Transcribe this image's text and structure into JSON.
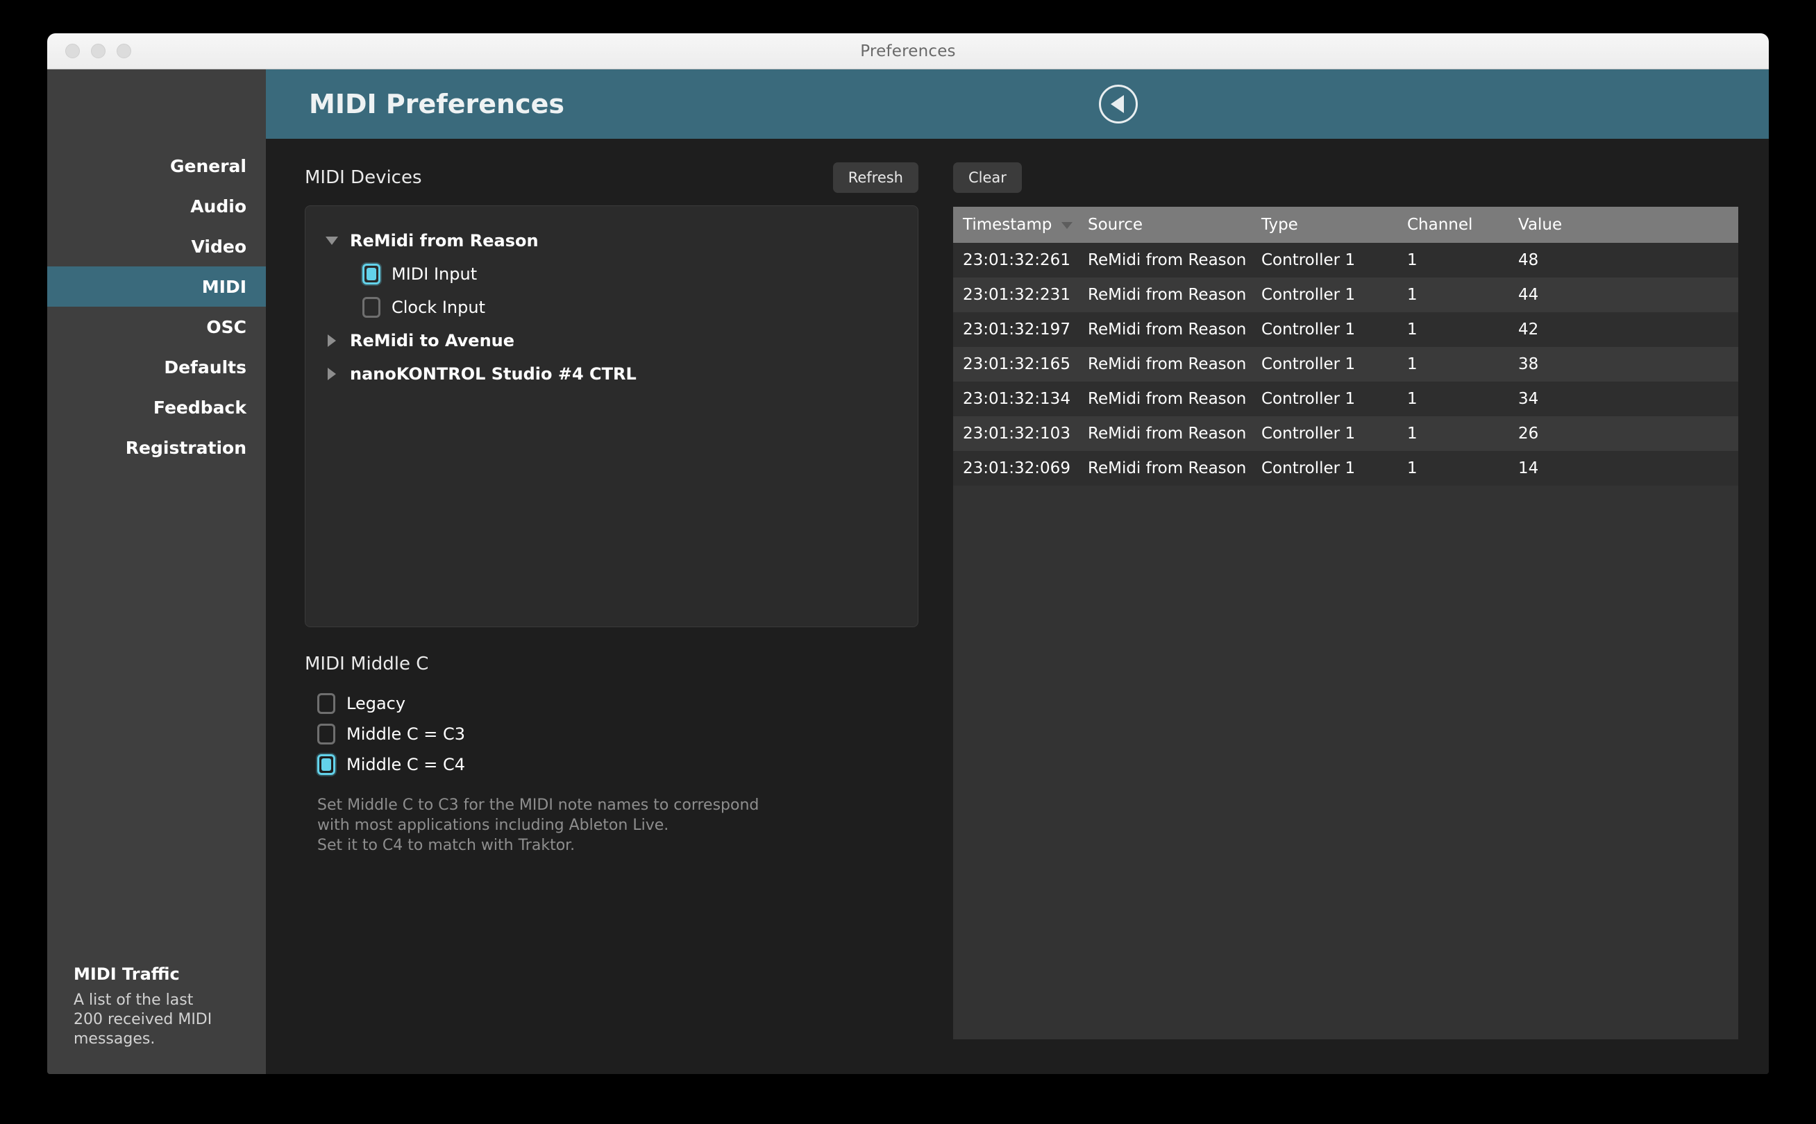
{
  "window": {
    "title": "Preferences",
    "traffic_lights": [
      "close-button",
      "minimize-button",
      "zoom-button"
    ]
  },
  "sidebar": {
    "items": [
      {
        "label": "General",
        "active": false
      },
      {
        "label": "Audio",
        "active": false
      },
      {
        "label": "Video",
        "active": false
      },
      {
        "label": "MIDI",
        "active": true
      },
      {
        "label": "OSC",
        "active": false
      },
      {
        "label": "Defaults",
        "active": false
      },
      {
        "label": "Feedback",
        "active": false
      },
      {
        "label": "Registration",
        "active": false
      }
    ],
    "footer": {
      "title": "MIDI Traffic",
      "description": "A list of the last\n200 received MIDI\nmessages."
    }
  },
  "header": {
    "title": "MIDI Preferences",
    "back_icon": "back-triangle-icon"
  },
  "devices_section": {
    "label": "MIDI Devices",
    "refresh_label": "Refresh",
    "tree": [
      {
        "name": "ReMidi from Reason",
        "expanded": true,
        "children": [
          {
            "label": "MIDI Input",
            "checked": true
          },
          {
            "label": "Clock Input",
            "checked": false
          }
        ]
      },
      {
        "name": "ReMidi to Avenue",
        "expanded": false,
        "children": []
      },
      {
        "name": "nanoKONTROL Studio #4 CTRL",
        "expanded": false,
        "children": []
      }
    ]
  },
  "middle_c": {
    "label": "MIDI Middle C",
    "options": [
      {
        "label": "Legacy",
        "checked": false
      },
      {
        "label": "Middle C = C3",
        "checked": false
      },
      {
        "label": "Middle C = C4",
        "checked": true
      }
    ],
    "help": "Set Middle C to C3 for the MIDI note names to correspond\nwith most applications including Ableton Live.\nSet it to C4 to match with Traktor."
  },
  "traffic": {
    "clear_label": "Clear",
    "columns": [
      "Timestamp",
      "Source",
      "Type",
      "Channel",
      "Value"
    ],
    "sorted_column": "Timestamp",
    "sort_direction": "descending",
    "rows": [
      {
        "timestamp": "23:01:32:261",
        "source": "ReMidi from Reason",
        "type": "Controller 1",
        "channel": "1",
        "value": "48"
      },
      {
        "timestamp": "23:01:32:231",
        "source": "ReMidi from Reason",
        "type": "Controller 1",
        "channel": "1",
        "value": "44"
      },
      {
        "timestamp": "23:01:32:197",
        "source": "ReMidi from Reason",
        "type": "Controller 1",
        "channel": "1",
        "value": "42"
      },
      {
        "timestamp": "23:01:32:165",
        "source": "ReMidi from Reason",
        "type": "Controller 1",
        "channel": "1",
        "value": "38"
      },
      {
        "timestamp": "23:01:32:134",
        "source": "ReMidi from Reason",
        "type": "Controller 1",
        "channel": "1",
        "value": "34"
      },
      {
        "timestamp": "23:01:32:103",
        "source": "ReMidi from Reason",
        "type": "Controller 1",
        "channel": "1",
        "value": "26"
      },
      {
        "timestamp": "23:01:32:069",
        "source": "ReMidi from Reason",
        "type": "Controller 1",
        "channel": "1",
        "value": "14"
      }
    ]
  },
  "colors": {
    "accent_teal": "#3a6a7c",
    "checkbox_cyan": "#63d2ea",
    "sidebar_bg": "#3f3f3f",
    "content_bg": "#1e1e1e",
    "panel_bg": "#2b2b2b",
    "table_header_bg": "#7b7b7b"
  }
}
